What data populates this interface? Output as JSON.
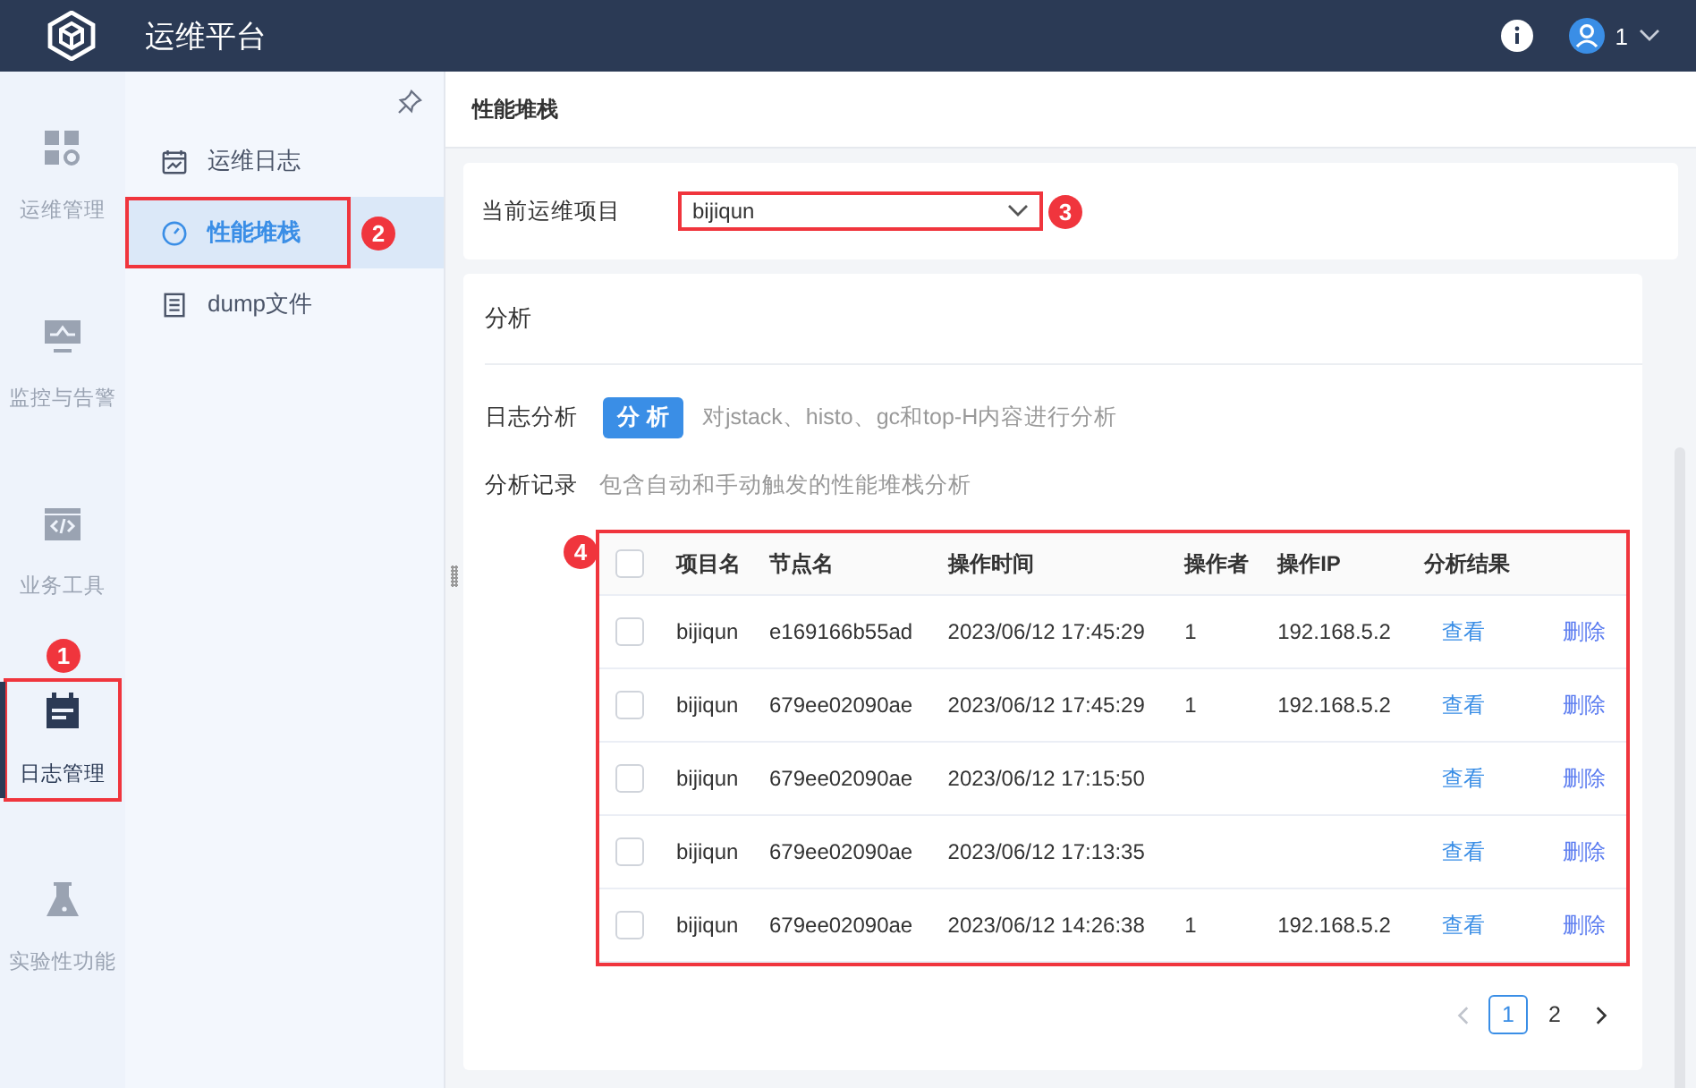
{
  "app": {
    "title": "运维平台",
    "user": "1"
  },
  "rail": [
    {
      "label": "运维管理",
      "kind": "grid",
      "selected": false
    },
    {
      "label": "监控与告警",
      "kind": "monitor",
      "selected": false
    },
    {
      "label": "业务工具",
      "kind": "code",
      "selected": false
    },
    {
      "label": "日志管理",
      "kind": "calendar",
      "selected": true,
      "callout": "1"
    },
    {
      "label": "实验性功能",
      "kind": "flask",
      "selected": false
    }
  ],
  "submenu": [
    {
      "label": "运维日志",
      "kind": "chart",
      "selected": false
    },
    {
      "label": "性能堆栈",
      "kind": "gauge",
      "selected": true,
      "callout": "2"
    },
    {
      "label": "dump文件",
      "kind": "doc",
      "selected": false
    }
  ],
  "breadcrumb": "性能堆栈",
  "project": {
    "label": "当前运维项目",
    "value": "bijiqun",
    "callout": "3"
  },
  "analysis": {
    "title": "分析",
    "log_label": "日志分析",
    "button": "分 析",
    "log_hint": "对jstack、histo、gc和top-H内容进行分析",
    "record_label": "分析记录",
    "record_hint": "包含自动和手动触发的性能堆栈分析"
  },
  "table": {
    "callout": "4",
    "all_checked": false,
    "columns": [
      "项目名",
      "节点名",
      "操作时间",
      "操作者",
      "操作IP",
      "分析结果"
    ],
    "rows": [
      {
        "checked": false,
        "cells": [
          "bijiqun",
          "e169166b55ad",
          "2023/06/12 17:45:29",
          "1",
          "192.168.5.2"
        ],
        "view": "查看",
        "delete": "删除"
      },
      {
        "checked": false,
        "cells": [
          "bijiqun",
          "679ee02090ae",
          "2023/06/12 17:45:29",
          "1",
          "192.168.5.2"
        ],
        "view": "查看",
        "delete": "删除"
      },
      {
        "checked": false,
        "cells": [
          "bijiqun",
          "679ee02090ae",
          "2023/06/12 17:15:50",
          "",
          ""
        ],
        "view": "查看",
        "delete": "删除"
      },
      {
        "checked": false,
        "cells": [
          "bijiqun",
          "679ee02090ae",
          "2023/06/12 17:13:35",
          "",
          ""
        ],
        "view": "查看",
        "delete": "删除"
      },
      {
        "checked": false,
        "cells": [
          "bijiqun",
          "679ee02090ae",
          "2023/06/12 14:26:38",
          "1",
          "192.168.5.2"
        ],
        "view": "查看",
        "delete": "删除"
      }
    ]
  },
  "pagination": {
    "prev_disabled": true,
    "next_disabled": false,
    "pages": [
      {
        "label": "1",
        "selected": true
      },
      {
        "label": "2",
        "selected": false
      }
    ]
  }
}
